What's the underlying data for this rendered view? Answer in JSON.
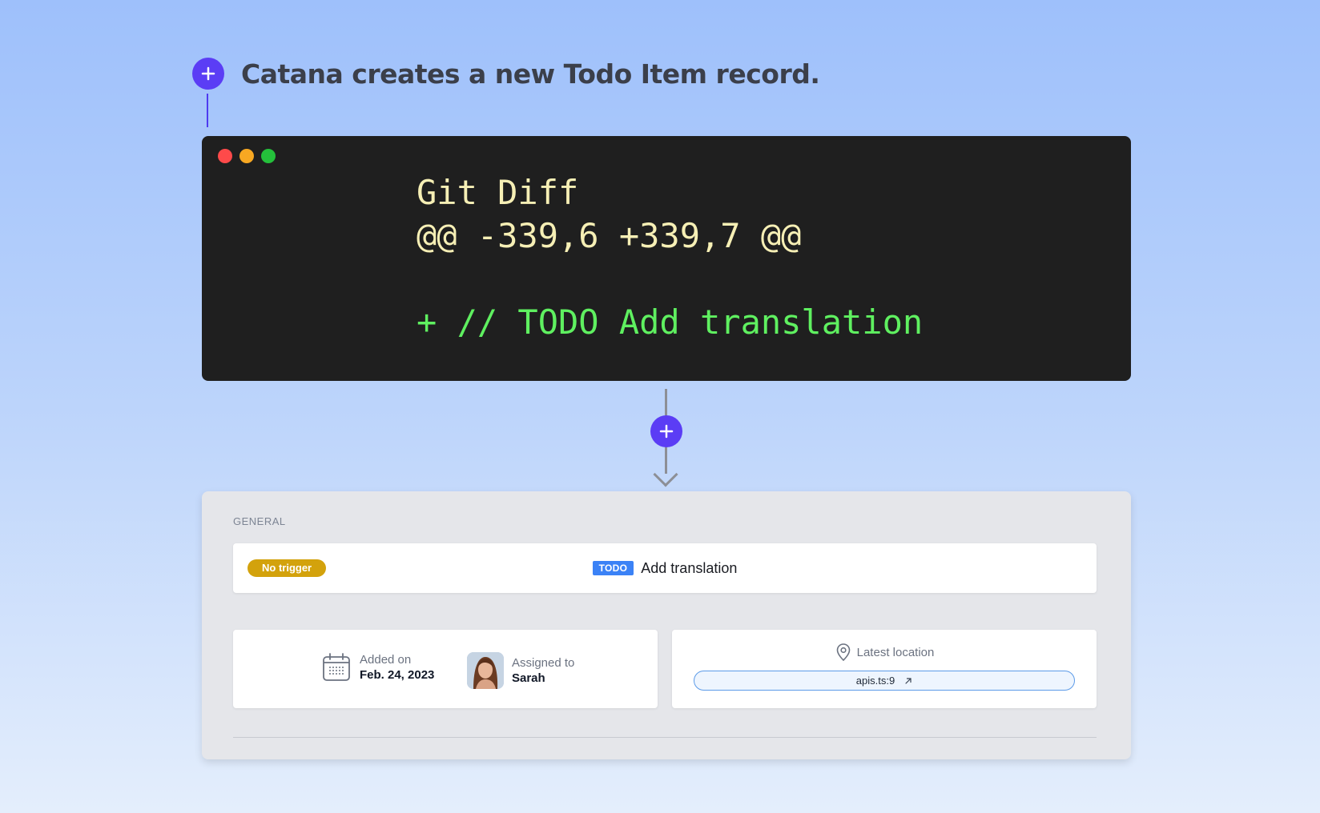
{
  "step": {
    "title": "Catana creates a new Todo Item record.",
    "icon": "plus-icon",
    "accent_color": "#5b3df5"
  },
  "terminal": {
    "lines": [
      "Git Diff",
      "@@ -339,6 +339,7 @@",
      "",
      "+ // TODO Add translation"
    ],
    "window_controls": [
      "close",
      "minimize",
      "maximize"
    ]
  },
  "record": {
    "section_label": "GENERAL",
    "trigger_badge": "No trigger",
    "tag": "TODO",
    "title": "Add translation",
    "added": {
      "label": "Added on",
      "value": "Feb. 24, 2023",
      "icon": "calendar-icon"
    },
    "assigned": {
      "label": "Assigned to",
      "value": "Sarah",
      "icon": "avatar"
    },
    "location": {
      "label": "Latest location",
      "value": "apis.ts:9",
      "icon": "map-pin-icon",
      "link_icon": "external-link-icon"
    }
  }
}
